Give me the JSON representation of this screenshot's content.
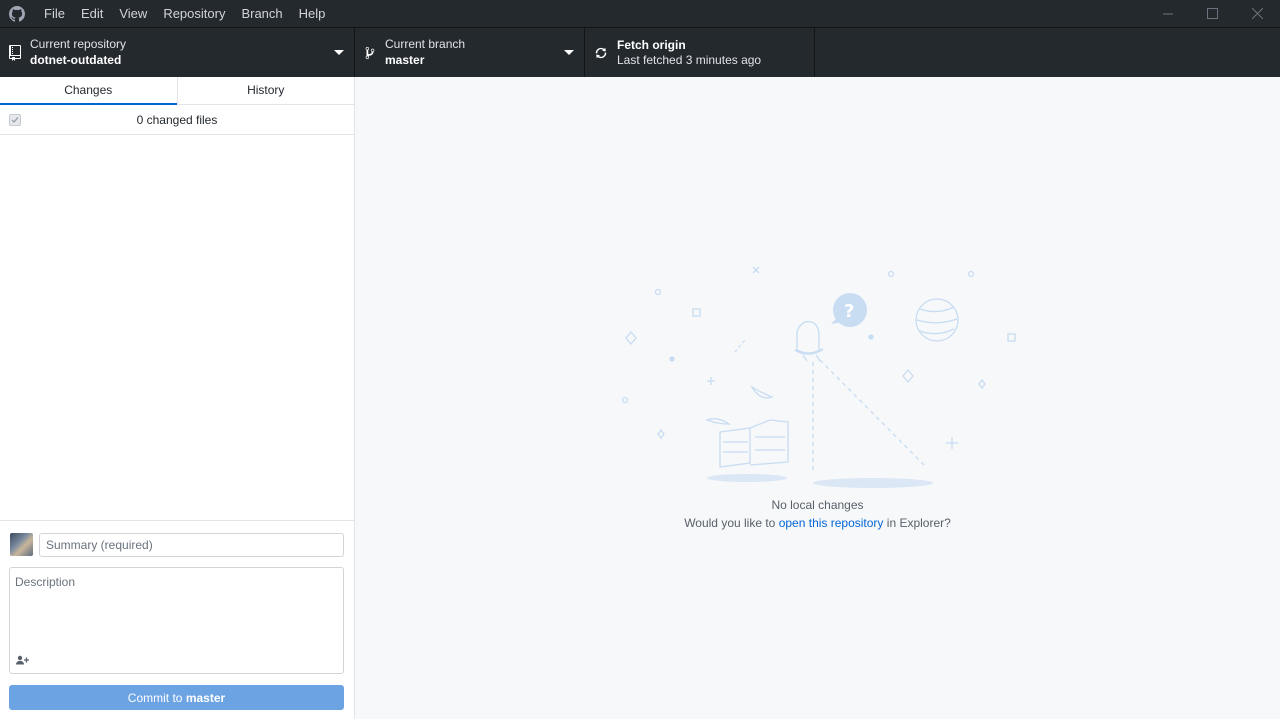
{
  "menu": [
    "File",
    "Edit",
    "View",
    "Repository",
    "Branch",
    "Help"
  ],
  "toolbar": {
    "repository": {
      "label": "Current repository",
      "value": "dotnet-outdated"
    },
    "branch": {
      "label": "Current branch",
      "value": "master"
    },
    "fetch": {
      "label": "Fetch origin",
      "value": "Last fetched 3 minutes ago"
    }
  },
  "tabs": {
    "changes": "Changes",
    "history": "History"
  },
  "changes": {
    "count_text": "0 changed files"
  },
  "commit": {
    "summary_placeholder": "Summary (required)",
    "description_placeholder": "Description",
    "button_prefix": "Commit to",
    "button_branch": "master"
  },
  "blank_slate": {
    "title": "No local changes",
    "prompt_before": "Would you like to",
    "link": "open this repository",
    "prompt_after": "in Explorer?"
  },
  "colors": {
    "titlebar": "#24292e",
    "accent": "#0366d6",
    "commit_button": "#6ca3e3"
  }
}
